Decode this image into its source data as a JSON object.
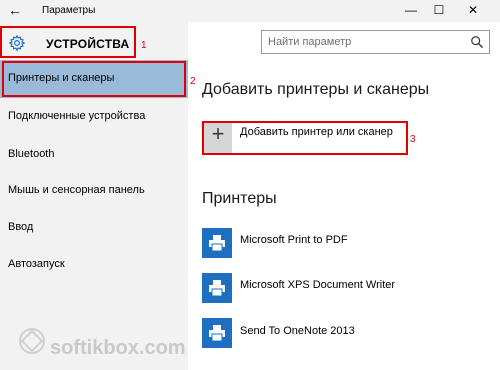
{
  "window": {
    "back_glyph": "←",
    "title": "Параметры",
    "controls": {
      "minimize": "—",
      "maximize": "☐",
      "close": "✕"
    }
  },
  "category": {
    "icon": "gear-icon",
    "title": "УСТРОЙСТВА"
  },
  "search": {
    "placeholder": "Найти параметр",
    "icon": "search-icon"
  },
  "annotations": [
    "1",
    "2",
    "3"
  ],
  "sidebar": {
    "items": [
      {
        "label": "Принтеры и сканеры",
        "selected": true
      },
      {
        "label": "Подключенные устройства",
        "selected": false
      },
      {
        "label": "Bluetooth",
        "selected": false
      },
      {
        "label": "Мышь и сенсорная панель",
        "selected": false
      },
      {
        "label": "Ввод",
        "selected": false
      },
      {
        "label": "Автозапуск",
        "selected": false
      }
    ]
  },
  "main": {
    "add_heading": "Добавить принтеры и сканеры",
    "add_button": {
      "icon": "plus-icon",
      "label": "Добавить принтер или сканер"
    },
    "printers_heading": "Принтеры",
    "printers": [
      {
        "icon": "printer-icon",
        "name": "Microsoft Print to PDF"
      },
      {
        "icon": "printer-icon",
        "name": "Microsoft XPS Document Writer"
      },
      {
        "icon": "printer-icon",
        "name": "Send To OneNote 2013"
      }
    ]
  },
  "watermark": {
    "text": "softikbox.com"
  },
  "colors": {
    "accent": "#1e6fc2",
    "selected_bg": "#99bbd9",
    "annotation_red": "#e00000",
    "sidebar_bg": "#f2f2f2"
  }
}
